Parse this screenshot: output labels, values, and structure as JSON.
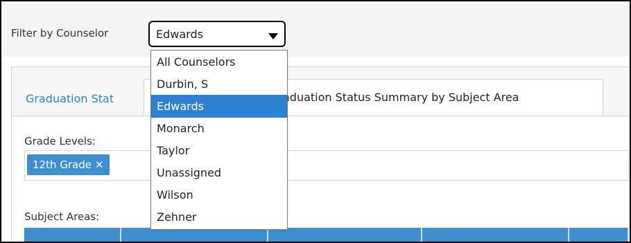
{
  "filter": {
    "label": "Filter by Counselor",
    "selected": "Edwards"
  },
  "tabs": [
    {
      "label": "Graduation Stat"
    },
    {
      "label": "aduation Status Summary by Subject Area"
    }
  ],
  "grade_levels": {
    "label": "Grade Levels:",
    "chip": "12th Grade",
    "remove": "✕"
  },
  "subject_areas": {
    "label": "Subject Areas:"
  },
  "counselor_options": [
    "All Counselors",
    "Durbin, S",
    "Edwards",
    "Monarch",
    "Taylor",
    "Unassigned",
    "Wilson",
    "Zehner"
  ],
  "colors": {
    "accent": "#2d82d2",
    "chip": "#3d8fd0",
    "tab_link": "#2e86c1"
  }
}
